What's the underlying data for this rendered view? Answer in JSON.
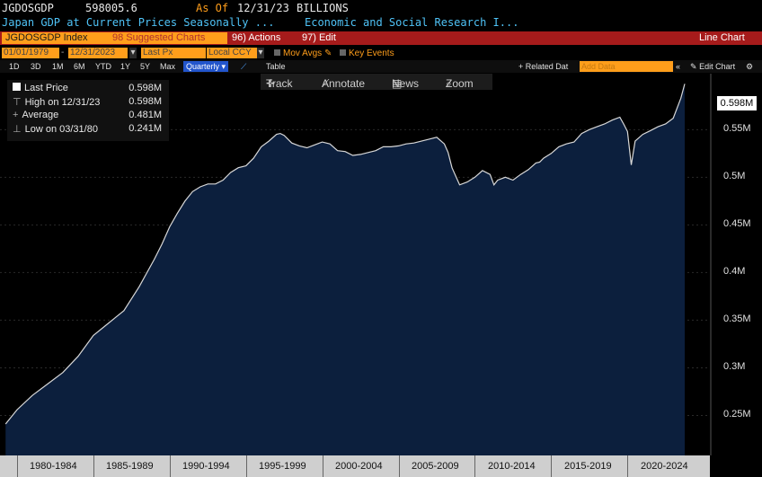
{
  "header": {
    "ticker": "JGDOSGDP",
    "value": "598005.6",
    "as_of_label": "As Of",
    "as_of_date": "12/31/23",
    "units": "BILLIONS",
    "description": "Japan GDP at Current Prices Seasonally ...",
    "source": "Economic and Social Research I..."
  },
  "toolbar1": {
    "ticker_field": "JGDOSGDP Index",
    "suggested": "98 Suggested Charts",
    "actions": "96) Actions",
    "edit": "97) Edit",
    "chart_type": "Line Chart"
  },
  "toolbar2": {
    "start_date": "01/01/1979",
    "end_date": "12/31/2023",
    "field": "Last Px",
    "currency": "Local CCY",
    "mov_avgs": "Mov Avgs",
    "key_events": "Key Events"
  },
  "toolbar3": {
    "periods": [
      "1D",
      "3D",
      "1M",
      "6M",
      "YTD",
      "1Y",
      "5Y",
      "Max"
    ],
    "frequency": "Quarterly",
    "table": "Table",
    "related": "+ Related Dat",
    "add_data": "Add Data",
    "edit_chart": "Edit Chart"
  },
  "chart_tools": [
    "Track",
    "Annotate",
    "News",
    "Zoom"
  ],
  "legend": {
    "last_price_label": "Last Price",
    "last_price_value": "0.598M",
    "high_label": "High on 12/31/23",
    "high_value": "0.598M",
    "average_label": "Average",
    "average_value": "0.481M",
    "low_label": "Low on 03/31/80",
    "low_value": "0.241M"
  },
  "last_value_box": "0.598M",
  "colors": {
    "fill": "#0c1f3d",
    "line": "#ffffff",
    "accent": "#ff9e1b",
    "menubar": "#a61b1b"
  },
  "chart_data": {
    "type": "area",
    "xlabel": "",
    "ylabel": "",
    "x_tick_labels": [
      "1980-1984",
      "1985-1989",
      "1990-1994",
      "1995-1999",
      "2000-2004",
      "2005-2009",
      "2010-2014",
      "2015-2019",
      "2020-2024"
    ],
    "y_tick_labels": [
      "0.25M",
      "0.3M",
      "0.35M",
      "0.4M",
      "0.45M",
      "0.5M",
      "0.55M"
    ],
    "y_ticks": [
      0.25,
      0.3,
      0.35,
      0.4,
      0.45,
      0.5,
      0.55
    ],
    "ylim": [
      0.208,
      0.605
    ],
    "xlim": [
      1979.0,
      2024.4
    ],
    "x": [
      1979.25,
      1980,
      1981,
      1982,
      1983,
      1984,
      1985,
      1986,
      1987,
      1988,
      1989,
      1989.5,
      1990,
      1990.5,
      1991,
      1991.5,
      1992,
      1992.5,
      1993,
      1993.5,
      1994,
      1994.5,
      1995,
      1995.5,
      1996,
      1996.5,
      1997,
      1997.25,
      1997.5,
      1998,
      1998.5,
      1999,
      1999.5,
      2000,
      2000.5,
      2001,
      2001.5,
      2002,
      2002.5,
      2003,
      2003.5,
      2004,
      2004.5,
      2005,
      2005.5,
      2006,
      2006.5,
      2007,
      2007.5,
      2008,
      2008.25,
      2008.5,
      2009,
      2009.5,
      2010,
      2010.5,
      2011,
      2011.25,
      2011.5,
      2012,
      2012.5,
      2013,
      2013.5,
      2014,
      2014.25,
      2014.5,
      2015,
      2015.5,
      2016,
      2016.5,
      2017,
      2017.5,
      2018,
      2018.5,
      2019,
      2019.5,
      2019.75,
      2020,
      2020.25,
      2020.5,
      2021,
      2021.5,
      2022,
      2022.5,
      2023,
      2023.5,
      2023.75
    ],
    "values": [
      0.241,
      0.256,
      0.271,
      0.283,
      0.295,
      0.312,
      0.334,
      0.347,
      0.36,
      0.385,
      0.414,
      0.43,
      0.448,
      0.462,
      0.475,
      0.485,
      0.49,
      0.493,
      0.493,
      0.497,
      0.505,
      0.51,
      0.512,
      0.52,
      0.532,
      0.538,
      0.545,
      0.546,
      0.544,
      0.536,
      0.533,
      0.531,
      0.534,
      0.537,
      0.535,
      0.528,
      0.527,
      0.523,
      0.524,
      0.526,
      0.528,
      0.532,
      0.532,
      0.533,
      0.535,
      0.536,
      0.538,
      0.54,
      0.542,
      0.535,
      0.526,
      0.51,
      0.492,
      0.495,
      0.5,
      0.507,
      0.503,
      0.492,
      0.497,
      0.5,
      0.497,
      0.503,
      0.508,
      0.515,
      0.516,
      0.52,
      0.525,
      0.532,
      0.535,
      0.537,
      0.546,
      0.55,
      0.553,
      0.556,
      0.56,
      0.563,
      0.556,
      0.548,
      0.513,
      0.538,
      0.545,
      0.549,
      0.553,
      0.556,
      0.562,
      0.583,
      0.598
    ]
  }
}
